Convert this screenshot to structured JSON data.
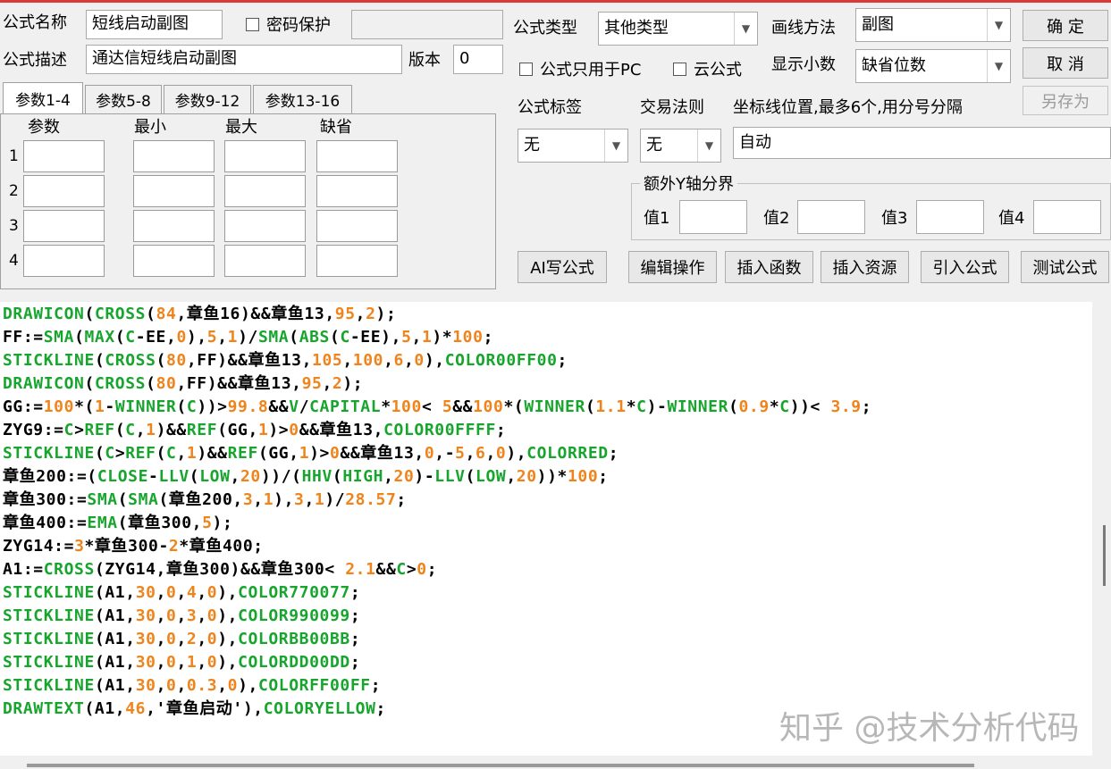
{
  "header": {
    "name_label": "公式名称",
    "name_value": "短线启动副图",
    "password_label": "密码保护",
    "desc_label": "公式描述",
    "desc_value": "通达信短线启动副图",
    "version_label": "版本",
    "version_value": "0",
    "type_label": "公式类型",
    "type_value": "其他类型",
    "draw_label": "画线方法",
    "draw_value": "副图",
    "pc_only_label": "公式只用于PC",
    "cloud_label": "云公式",
    "decimals_label": "显示小数",
    "decimals_value": "缺省位数"
  },
  "buttons": {
    "ok": "确 定",
    "cancel": "取 消",
    "save_as": "另存为",
    "ai_write": "AI写公式",
    "edit_ops": "编辑操作",
    "insert_func": "插入函数",
    "insert_res": "插入资源",
    "import_formula": "引入公式",
    "test_formula": "测试公式"
  },
  "tabs": [
    "参数1-4",
    "参数5-8",
    "参数9-12",
    "参数13-16"
  ],
  "params": {
    "col_param": "参数",
    "col_min": "最小",
    "col_max": "最大",
    "col_default": "缺省",
    "rows": [
      "1",
      "2",
      "3",
      "4"
    ]
  },
  "right": {
    "tag_label": "公式标签",
    "tag_value": "无",
    "rule_label": "交易法则",
    "rule_value": "无",
    "axis_label": "坐标线位置,最多6个,用分号分隔",
    "axis_value": "自动",
    "extra_y_label": "额外Y轴分界",
    "v1": "值1",
    "v2": "值2",
    "v3": "值3",
    "v4": "值4"
  },
  "code_lines": [
    [
      [
        "g",
        "DRAWICON"
      ],
      [
        "k",
        "("
      ],
      [
        "g",
        "CROSS"
      ],
      [
        "k",
        "("
      ],
      [
        "o",
        "84"
      ],
      [
        "k",
        ",章鱼16)&&章鱼13,"
      ],
      [
        "o",
        "95"
      ],
      [
        "k",
        ","
      ],
      [
        "o",
        "2"
      ],
      [
        "k",
        ");"
      ]
    ],
    [
      [
        "k",
        "FF:="
      ],
      [
        "g",
        "SMA"
      ],
      [
        "k",
        "("
      ],
      [
        "g",
        "MAX"
      ],
      [
        "k",
        "("
      ],
      [
        "g",
        "C"
      ],
      [
        "k",
        "-EE,"
      ],
      [
        "o",
        "0"
      ],
      [
        "k",
        "),"
      ],
      [
        "o",
        "5"
      ],
      [
        "k",
        ","
      ],
      [
        "o",
        "1"
      ],
      [
        "k",
        ")/"
      ],
      [
        "g",
        "SMA"
      ],
      [
        "k",
        "("
      ],
      [
        "g",
        "ABS"
      ],
      [
        "k",
        "("
      ],
      [
        "g",
        "C"
      ],
      [
        "k",
        "-EE),"
      ],
      [
        "o",
        "5"
      ],
      [
        "k",
        ","
      ],
      [
        "o",
        "1"
      ],
      [
        "k",
        ")*"
      ],
      [
        "o",
        "100"
      ],
      [
        "k",
        ";"
      ]
    ],
    [
      [
        "g",
        "STICKLINE"
      ],
      [
        "k",
        "("
      ],
      [
        "g",
        "CROSS"
      ],
      [
        "k",
        "("
      ],
      [
        "o",
        "80"
      ],
      [
        "k",
        ",FF)&&章鱼13,"
      ],
      [
        "o",
        "105"
      ],
      [
        "k",
        ","
      ],
      [
        "o",
        "100"
      ],
      [
        "k",
        ","
      ],
      [
        "o",
        "6"
      ],
      [
        "k",
        ","
      ],
      [
        "o",
        "0"
      ],
      [
        "k",
        "),"
      ],
      [
        "g",
        "COLOR00FF00"
      ],
      [
        "k",
        ";"
      ]
    ],
    [
      [
        "g",
        "DRAWICON"
      ],
      [
        "k",
        "("
      ],
      [
        "g",
        "CROSS"
      ],
      [
        "k",
        "("
      ],
      [
        "o",
        "80"
      ],
      [
        "k",
        ",FF)&&章鱼13,"
      ],
      [
        "o",
        "95"
      ],
      [
        "k",
        ","
      ],
      [
        "o",
        "2"
      ],
      [
        "k",
        ");"
      ]
    ],
    [
      [
        "k",
        "GG:="
      ],
      [
        "o",
        "100"
      ],
      [
        "k",
        "*("
      ],
      [
        "o",
        "1"
      ],
      [
        "k",
        "-"
      ],
      [
        "g",
        "WINNER"
      ],
      [
        "k",
        "("
      ],
      [
        "g",
        "C"
      ],
      [
        "k",
        "))>"
      ],
      [
        "o",
        "99.8"
      ],
      [
        "k",
        "&&"
      ],
      [
        "g",
        "V"
      ],
      [
        "k",
        "/"
      ],
      [
        "g",
        "CAPITAL"
      ],
      [
        "k",
        "*"
      ],
      [
        "o",
        "100"
      ],
      [
        "k",
        "< "
      ],
      [
        "o",
        "5"
      ],
      [
        "k",
        "&&"
      ],
      [
        "o",
        "100"
      ],
      [
        "k",
        "*("
      ],
      [
        "g",
        "WINNER"
      ],
      [
        "k",
        "("
      ],
      [
        "o",
        "1.1"
      ],
      [
        "k",
        "*"
      ],
      [
        "g",
        "C"
      ],
      [
        "k",
        ")-"
      ],
      [
        "g",
        "WINNER"
      ],
      [
        "k",
        "("
      ],
      [
        "o",
        "0.9"
      ],
      [
        "k",
        "*"
      ],
      [
        "g",
        "C"
      ],
      [
        "k",
        "))< "
      ],
      [
        "o",
        "3.9"
      ],
      [
        "k",
        ";"
      ]
    ],
    [
      [
        "k",
        "ZYG9:="
      ],
      [
        "g",
        "C"
      ],
      [
        "k",
        ">"
      ],
      [
        "g",
        "REF"
      ],
      [
        "k",
        "("
      ],
      [
        "g",
        "C"
      ],
      [
        "k",
        ","
      ],
      [
        "o",
        "1"
      ],
      [
        "k",
        ")&&"
      ],
      [
        "g",
        "REF"
      ],
      [
        "k",
        "(GG,"
      ],
      [
        "o",
        "1"
      ],
      [
        "k",
        ")>"
      ],
      [
        "o",
        "0"
      ],
      [
        "k",
        "&&章鱼13,"
      ],
      [
        "g",
        "COLOR00FFFF"
      ],
      [
        "k",
        ";"
      ]
    ],
    [
      [
        "g",
        "STICKLINE"
      ],
      [
        "k",
        "("
      ],
      [
        "g",
        "C"
      ],
      [
        "k",
        ">"
      ],
      [
        "g",
        "REF"
      ],
      [
        "k",
        "("
      ],
      [
        "g",
        "C"
      ],
      [
        "k",
        ","
      ],
      [
        "o",
        "1"
      ],
      [
        "k",
        ")&&"
      ],
      [
        "g",
        "REF"
      ],
      [
        "k",
        "(GG,"
      ],
      [
        "o",
        "1"
      ],
      [
        "k",
        ")>"
      ],
      [
        "o",
        "0"
      ],
      [
        "k",
        "&&章鱼13,"
      ],
      [
        "o",
        "0"
      ],
      [
        "k",
        ",-"
      ],
      [
        "o",
        "5"
      ],
      [
        "k",
        ","
      ],
      [
        "o",
        "6"
      ],
      [
        "k",
        ","
      ],
      [
        "o",
        "0"
      ],
      [
        "k",
        "),"
      ],
      [
        "g",
        "COLORRED"
      ],
      [
        "k",
        ";"
      ]
    ],
    [
      [
        "k",
        "章鱼200:=("
      ],
      [
        "g",
        "CLOSE"
      ],
      [
        "k",
        "-"
      ],
      [
        "g",
        "LLV"
      ],
      [
        "k",
        "("
      ],
      [
        "g",
        "LOW"
      ],
      [
        "k",
        ","
      ],
      [
        "o",
        "20"
      ],
      [
        "k",
        "))/("
      ],
      [
        "g",
        "HHV"
      ],
      [
        "k",
        "("
      ],
      [
        "g",
        "HIGH"
      ],
      [
        "k",
        ","
      ],
      [
        "o",
        "20"
      ],
      [
        "k",
        ")-"
      ],
      [
        "g",
        "LLV"
      ],
      [
        "k",
        "("
      ],
      [
        "g",
        "LOW"
      ],
      [
        "k",
        ","
      ],
      [
        "o",
        "20"
      ],
      [
        "k",
        "))*"
      ],
      [
        "o",
        "100"
      ],
      [
        "k",
        ";"
      ]
    ],
    [
      [
        "k",
        "章鱼300:="
      ],
      [
        "g",
        "SMA"
      ],
      [
        "k",
        "("
      ],
      [
        "g",
        "SMA"
      ],
      [
        "k",
        "(章鱼200,"
      ],
      [
        "o",
        "3"
      ],
      [
        "k",
        ","
      ],
      [
        "o",
        "1"
      ],
      [
        "k",
        "),"
      ],
      [
        "o",
        "3"
      ],
      [
        "k",
        ","
      ],
      [
        "o",
        "1"
      ],
      [
        "k",
        ")/"
      ],
      [
        "o",
        "28.57"
      ],
      [
        "k",
        ";"
      ]
    ],
    [
      [
        "k",
        "章鱼400:="
      ],
      [
        "g",
        "EMA"
      ],
      [
        "k",
        "(章鱼300,"
      ],
      [
        "o",
        "5"
      ],
      [
        "k",
        ");"
      ]
    ],
    [
      [
        "k",
        "ZYG14:="
      ],
      [
        "o",
        "3"
      ],
      [
        "k",
        "*章鱼300-"
      ],
      [
        "o",
        "2"
      ],
      [
        "k",
        "*章鱼400;"
      ]
    ],
    [
      [
        "k",
        "A1:="
      ],
      [
        "g",
        "CROSS"
      ],
      [
        "k",
        "(ZYG14,章鱼300)&&章鱼300< "
      ],
      [
        "o",
        "2.1"
      ],
      [
        "k",
        "&&"
      ],
      [
        "g",
        "C"
      ],
      [
        "k",
        ">"
      ],
      [
        "o",
        "0"
      ],
      [
        "k",
        ";"
      ]
    ],
    [
      [
        "g",
        "STICKLINE"
      ],
      [
        "k",
        "(A1,"
      ],
      [
        "o",
        "30"
      ],
      [
        "k",
        ","
      ],
      [
        "o",
        "0"
      ],
      [
        "k",
        ","
      ],
      [
        "o",
        "4"
      ],
      [
        "k",
        ","
      ],
      [
        "o",
        "0"
      ],
      [
        "k",
        "),"
      ],
      [
        "g",
        "COLOR770077"
      ],
      [
        "k",
        ";"
      ]
    ],
    [
      [
        "g",
        "STICKLINE"
      ],
      [
        "k",
        "(A1,"
      ],
      [
        "o",
        "30"
      ],
      [
        "k",
        ","
      ],
      [
        "o",
        "0"
      ],
      [
        "k",
        ","
      ],
      [
        "o",
        "3"
      ],
      [
        "k",
        ","
      ],
      [
        "o",
        "0"
      ],
      [
        "k",
        "),"
      ],
      [
        "g",
        "COLOR990099"
      ],
      [
        "k",
        ";"
      ]
    ],
    [
      [
        "g",
        "STICKLINE"
      ],
      [
        "k",
        "(A1,"
      ],
      [
        "o",
        "30"
      ],
      [
        "k",
        ","
      ],
      [
        "o",
        "0"
      ],
      [
        "k",
        ","
      ],
      [
        "o",
        "2"
      ],
      [
        "k",
        ","
      ],
      [
        "o",
        "0"
      ],
      [
        "k",
        "),"
      ],
      [
        "g",
        "COLORBB00BB"
      ],
      [
        "k",
        ";"
      ]
    ],
    [
      [
        "g",
        "STICKLINE"
      ],
      [
        "k",
        "(A1,"
      ],
      [
        "o",
        "30"
      ],
      [
        "k",
        ","
      ],
      [
        "o",
        "0"
      ],
      [
        "k",
        ","
      ],
      [
        "o",
        "1"
      ],
      [
        "k",
        ","
      ],
      [
        "o",
        "0"
      ],
      [
        "k",
        "),"
      ],
      [
        "g",
        "COLORDD00DD"
      ],
      [
        "k",
        ";"
      ]
    ],
    [
      [
        "g",
        "STICKLINE"
      ],
      [
        "k",
        "(A1,"
      ],
      [
        "o",
        "30"
      ],
      [
        "k",
        ","
      ],
      [
        "o",
        "0"
      ],
      [
        "k",
        ","
      ],
      [
        "o",
        "0.3"
      ],
      [
        "k",
        ","
      ],
      [
        "o",
        "0"
      ],
      [
        "k",
        "),"
      ],
      [
        "g",
        "COLORFF00FF"
      ],
      [
        "k",
        ";"
      ]
    ],
    [
      [
        "g",
        "DRAWTEXT"
      ],
      [
        "k",
        "(A1,"
      ],
      [
        "o",
        "46"
      ],
      [
        "k",
        ",'章鱼启动'),"
      ],
      [
        "g",
        "COLORYELLOW"
      ],
      [
        "k",
        ";"
      ]
    ]
  ],
  "watermark": "知乎 @技术分析代码",
  "colors": {
    "keyword": "#17a52e",
    "number": "#f0841c",
    "text": "#000000"
  }
}
